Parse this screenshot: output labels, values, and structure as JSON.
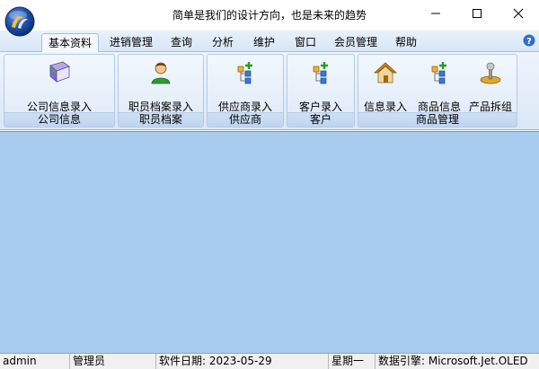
{
  "window": {
    "title": "简单是我们的设计方向，也是未来的趋势"
  },
  "menu": {
    "tabs": [
      {
        "label": "基本资料"
      },
      {
        "label": "进销管理"
      },
      {
        "label": "查询"
      },
      {
        "label": "分析"
      },
      {
        "label": "维护"
      },
      {
        "label": "窗口"
      },
      {
        "label": "会员管理"
      },
      {
        "label": "帮助"
      }
    ]
  },
  "ribbon": {
    "groups": [
      {
        "label": "公司信息",
        "buttons": [
          {
            "label": "公司信息录入",
            "icon": "book-icon"
          }
        ]
      },
      {
        "label": "职员档案",
        "buttons": [
          {
            "label": "职员档案录入",
            "icon": "user-icon"
          }
        ]
      },
      {
        "label": "供应商",
        "buttons": [
          {
            "label": "供应商录入",
            "icon": "tree-add-icon"
          }
        ]
      },
      {
        "label": "客户",
        "buttons": [
          {
            "label": "客户录入",
            "icon": "tree-add-icon"
          }
        ]
      },
      {
        "label": "商品管理",
        "buttons": [
          {
            "label": "信息录入",
            "icon": "house-icon"
          },
          {
            "label": "商品信息",
            "icon": "tree-add-icon"
          },
          {
            "label": "产品拆组",
            "icon": "joystick-icon"
          }
        ]
      }
    ]
  },
  "status": {
    "user": "admin",
    "role": "管理员",
    "software_date": "软件日期:  2023-05-29",
    "weekday": "星期一",
    "engine": "数据引擎:  Microsoft.Jet.OLED"
  },
  "colors": {
    "workspace": "#a8cbf0",
    "ribbon": "#dbe7f6"
  }
}
